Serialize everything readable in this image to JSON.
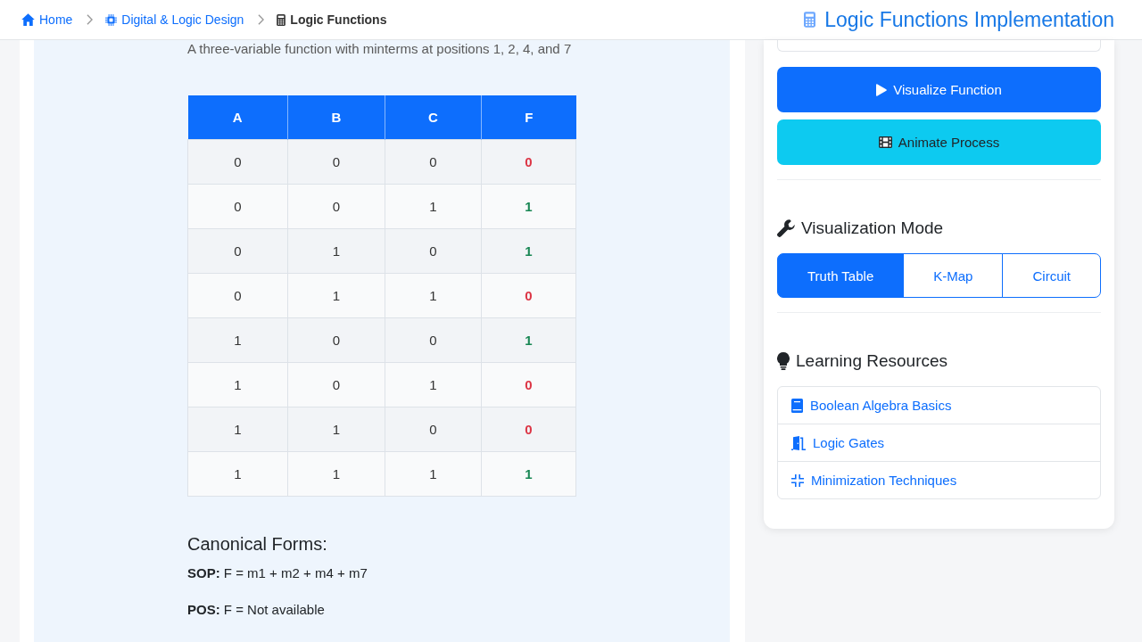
{
  "breadcrumb": [
    {
      "label": "Home",
      "current": false
    },
    {
      "label": "Digital & Logic Design",
      "current": false
    },
    {
      "label": "Logic Functions",
      "current": true
    }
  ],
  "header": {
    "title": "Logic Functions Implementation"
  },
  "function": {
    "description": "A three-variable function with minterms at positions 1, 2, 4, and 7",
    "table": {
      "columns": [
        "A",
        "B",
        "C",
        "F"
      ],
      "rows": [
        {
          "inputs": [
            "0",
            "0",
            "0"
          ],
          "output": {
            "text": "0",
            "high": false
          }
        },
        {
          "inputs": [
            "0",
            "0",
            "1"
          ],
          "output": {
            "text": "1",
            "high": true
          }
        },
        {
          "inputs": [
            "0",
            "1",
            "0"
          ],
          "output": {
            "text": "1",
            "high": true
          }
        },
        {
          "inputs": [
            "0",
            "1",
            "1"
          ],
          "output": {
            "text": "0",
            "high": false
          }
        },
        {
          "inputs": [
            "1",
            "0",
            "0"
          ],
          "output": {
            "text": "1",
            "high": true
          }
        },
        {
          "inputs": [
            "1",
            "0",
            "1"
          ],
          "output": {
            "text": "0",
            "high": false
          }
        },
        {
          "inputs": [
            "1",
            "1",
            "0"
          ],
          "output": {
            "text": "0",
            "high": false
          }
        },
        {
          "inputs": [
            "1",
            "1",
            "1"
          ],
          "output": {
            "text": "1",
            "high": true
          }
        }
      ]
    },
    "canonical_forms": {
      "heading": "Canonical Forms:",
      "lines": [
        "**SOP:** F = m1 + m2 + m4 + m7",
        "**POS:** F = Not available"
      ]
    }
  },
  "sidebar": {
    "actions": [
      {
        "label": "Visualize Function",
        "kind": "primary"
      },
      {
        "label": "Animate Process",
        "kind": "info"
      }
    ],
    "visualization_mode": {
      "heading": "Visualization Mode",
      "options": [
        {
          "label": "Truth Table",
          "selected": true
        },
        {
          "label": "K-Map",
          "selected": false
        },
        {
          "label": "Circuit",
          "selected": false
        }
      ]
    },
    "learning_resources": {
      "heading": "Learning Resources",
      "links": [
        {
          "label": "Boolean Algebra Basics"
        },
        {
          "label": "Logic Gates"
        },
        {
          "label": "Minimization Techniques"
        }
      ]
    }
  }
}
